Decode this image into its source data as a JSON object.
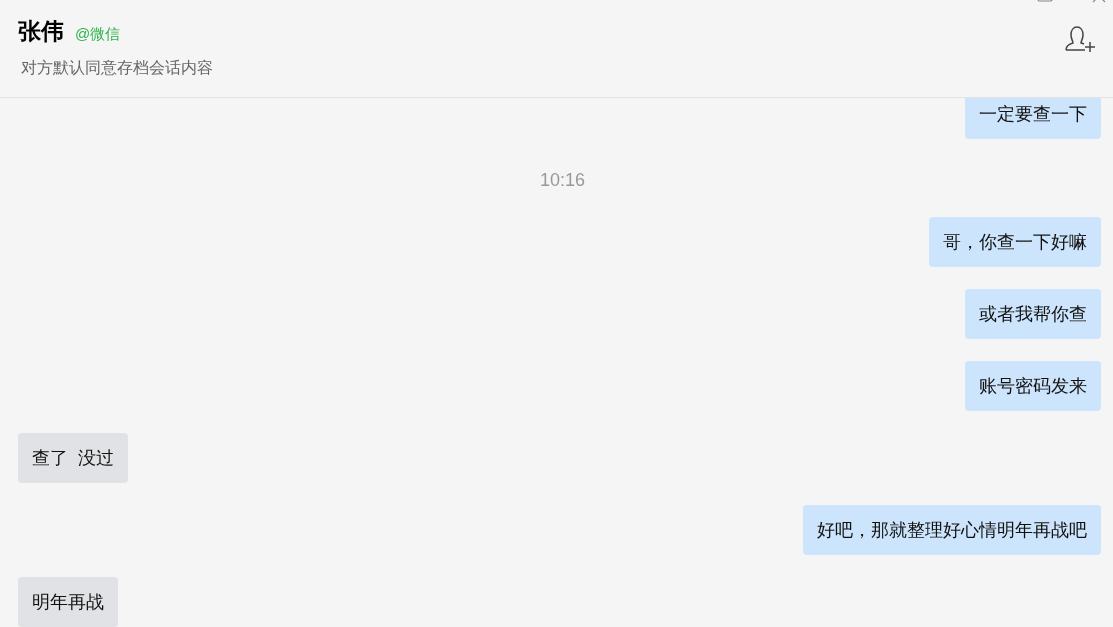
{
  "header": {
    "name": "张伟",
    "source": "@微信",
    "subtitle": "对方默认同意存档会话内容"
  },
  "messages": [
    {
      "kind": "outgoing",
      "text": "一定要查一下"
    },
    {
      "kind": "time",
      "text": "10:16"
    },
    {
      "kind": "outgoing",
      "text": "哥，你查一下好嘛"
    },
    {
      "kind": "outgoing",
      "text": "或者我帮你查"
    },
    {
      "kind": "outgoing",
      "text": "账号密码发来"
    },
    {
      "kind": "incoming",
      "text": "查了  没过"
    },
    {
      "kind": "outgoing",
      "text": "好吧，那就整理好心情明年再战吧"
    },
    {
      "kind": "incoming",
      "text": "明年再战"
    }
  ]
}
